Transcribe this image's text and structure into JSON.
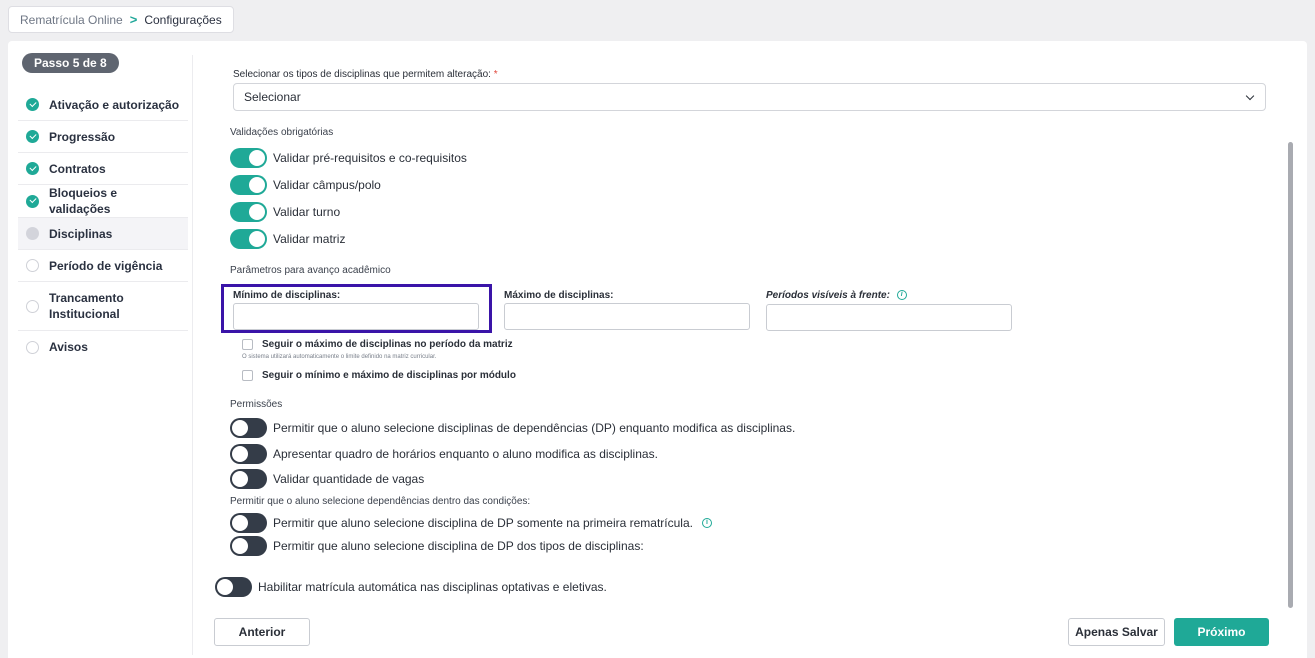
{
  "breadcrumb": {
    "root": "Rematrícula Online",
    "current": "Configurações"
  },
  "sidebar": {
    "step": "Passo 5 de 8",
    "items": [
      {
        "label": "Ativação e autorização",
        "state": "done"
      },
      {
        "label": "Progressão",
        "state": "done"
      },
      {
        "label": "Contratos",
        "state": "done"
      },
      {
        "label": "Bloqueios e validações",
        "state": "done"
      },
      {
        "label": "Disciplinas",
        "state": "current"
      },
      {
        "label": "Período de vigência",
        "state": "todo"
      },
      {
        "label": "Trancamento Institucional",
        "state": "todo"
      },
      {
        "label": "Avisos",
        "state": "todo"
      }
    ]
  },
  "main": {
    "types_label": "Selecionar os tipos de disciplinas que permitem alteração:",
    "required_mark": "*",
    "types_select_value": "Selecionar",
    "validations_title": "Validações obrigatórias",
    "validations": [
      {
        "label": "Validar pré-requisitos e co-requisitos",
        "on": true
      },
      {
        "label": "Validar câmpus/polo",
        "on": true
      },
      {
        "label": "Validar turno",
        "on": true
      },
      {
        "label": "Validar matriz",
        "on": true
      }
    ],
    "advance_title": "Parâmetros para avanço acadêmico",
    "min_label": "Mínimo de disciplinas:",
    "max_label": "Máximo de disciplinas:",
    "periods_label": "Períodos visíveis à frente:",
    "min_value": "",
    "max_value": "",
    "periods_value": "",
    "follow_max_label": "Seguir o máximo de disciplinas no período da matriz",
    "follow_max_hint": "O sistema utilizará automaticamente o limite definido na matriz curricular.",
    "follow_module_label": "Seguir o mínimo e máximo de disciplinas por módulo",
    "permissions_title": "Permissões",
    "permissions": [
      {
        "label": "Permitir que o aluno selecione disciplinas de dependências (DP) enquanto modifica as disciplinas.",
        "on": false
      },
      {
        "label": "Apresentar quadro de horários enquanto o aluno modifica as disciplinas.",
        "on": false
      },
      {
        "label": "Validar quantidade de vagas",
        "on": false
      }
    ],
    "conditions_title": "Permitir que o aluno selecione dependências dentro das condições:",
    "conditions": [
      {
        "label": "Permitir que aluno selecione disciplina de DP somente na primeira rematrícula.",
        "on": false
      },
      {
        "label": "Permitir que aluno selecione disciplina de DP dos tipos de disciplinas:",
        "on": false
      }
    ],
    "auto_enroll_label": "Habilitar matrícula automática nas disciplinas optativas e eletivas.",
    "info_glyph": "i"
  },
  "footer": {
    "back": "Anterior",
    "save": "Apenas Salvar",
    "next": "Próximo"
  },
  "colors": {
    "accent": "#1fa997",
    "focus": "#3a14a8",
    "toggle_off": "#343c48"
  }
}
